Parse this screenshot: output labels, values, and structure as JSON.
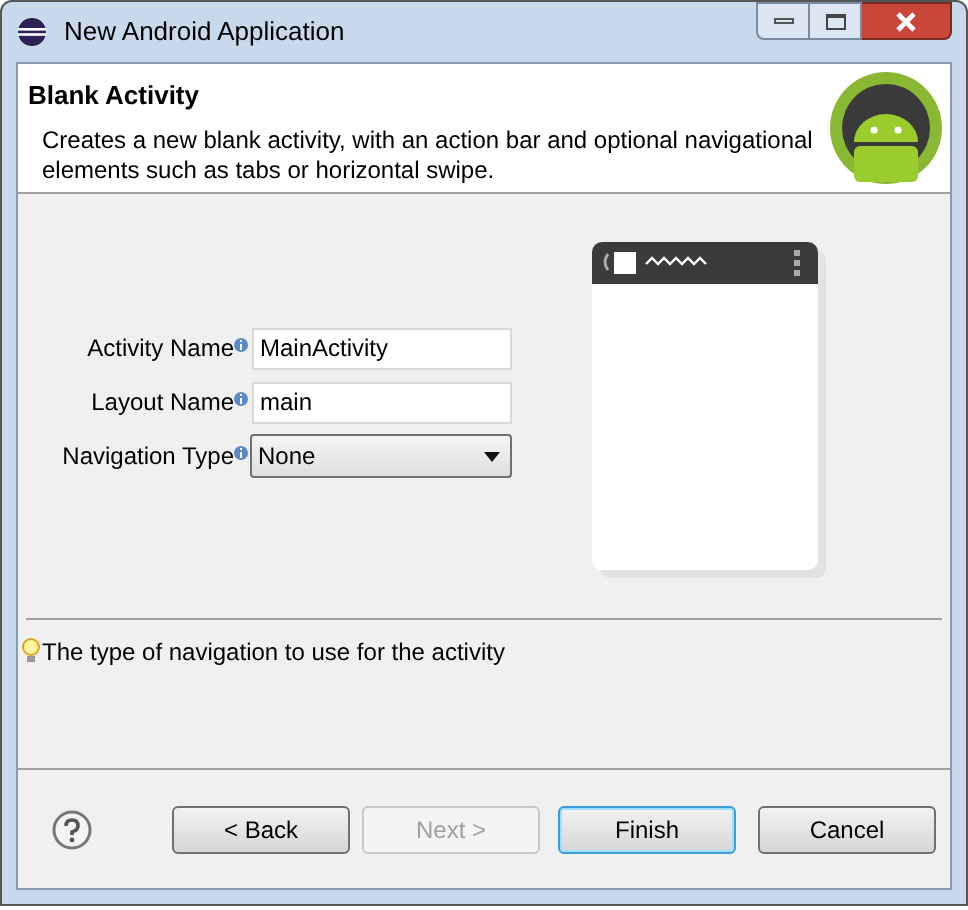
{
  "window": {
    "title": "New Android Application"
  },
  "header": {
    "title": "Blank Activity",
    "description": "Creates a new blank activity, with an action bar and optional navigational elements such as tabs or horizontal swipe."
  },
  "fields": [
    {
      "label": "Activity Name",
      "kind": "text",
      "value": "MainActivity"
    },
    {
      "label": "Layout Name",
      "kind": "text",
      "value": "main"
    },
    {
      "label": "Navigation Type",
      "kind": "dropdown",
      "value": "None"
    }
  ],
  "hint": "The type of navigation to use for the activity",
  "buttons": [
    {
      "label": "< Back",
      "disabled": false,
      "default": false
    },
    {
      "label": "Next >",
      "disabled": true,
      "default": false
    },
    {
      "label": "Finish",
      "disabled": false,
      "default": true
    },
    {
      "label": "Cancel",
      "disabled": false,
      "default": false
    }
  ]
}
